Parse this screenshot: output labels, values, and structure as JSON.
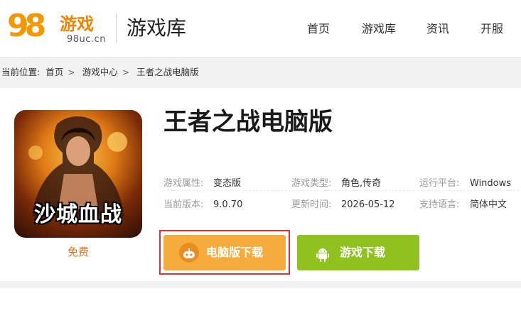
{
  "header": {
    "logo_digits": "98",
    "logo_text": "游戏",
    "logo_domain": "98uc.cn",
    "section_title": "游戏库",
    "nav": [
      "首页",
      "游戏库",
      "资讯",
      "开服"
    ]
  },
  "breadcrumb": {
    "prefix": "当前位置:",
    "items": [
      "首页",
      "游戏中心",
      "王者之战电脑版"
    ],
    "separator": ">"
  },
  "game": {
    "title": "王者之战电脑版",
    "cover_caption": "沙城血战",
    "price": "免费",
    "attributes": [
      {
        "label": "游戏属性:",
        "value": "变态版"
      },
      {
        "label": "游戏类型:",
        "value": "角色,传奇"
      },
      {
        "label": "运行平台:",
        "value": "Windows"
      },
      {
        "label": "当前版本:",
        "value": "9.0.70"
      },
      {
        "label": "更新时间:",
        "value": "2026-05-12"
      },
      {
        "label": "支持语言:",
        "value": "简体中文"
      }
    ]
  },
  "buttons": {
    "pc_download": "电脑版下载",
    "game_download": "游戏下载"
  },
  "colors": {
    "pc_button": "#f6ac3c",
    "game_button": "#8fc21e",
    "highlight_frame": "#d9343a",
    "price": "#e4711a"
  },
  "icons": {
    "pc_button_icon": "gamepad-icon",
    "game_button_icon": "android-icon"
  }
}
